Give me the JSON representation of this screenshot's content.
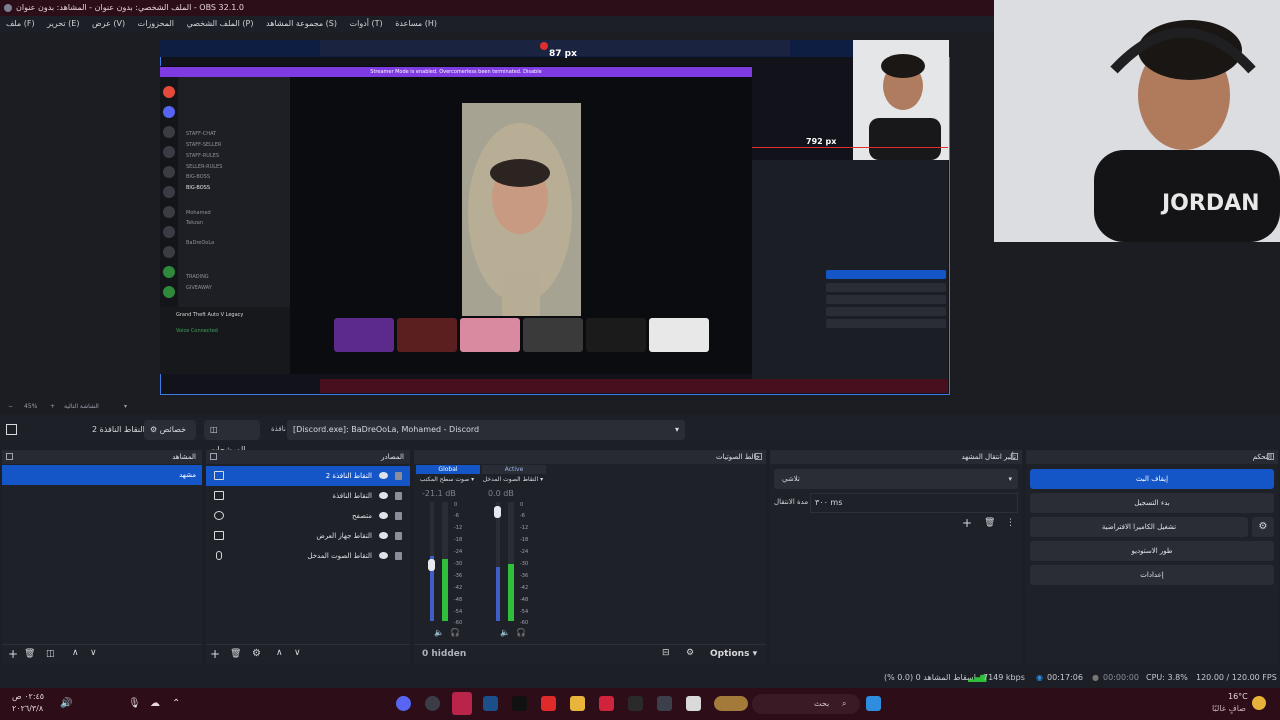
{
  "window": {
    "title": "الملف الشخصي: بدون عنوان - المشاهد: بدون عنوان - OBS 32.1.0"
  },
  "menu": [
    "ملف (F)",
    "تحرير (E)",
    "عرض (V)",
    "المحزوزات",
    "الملف الشخصي (P)",
    "مجموعة المشاهد (S)",
    "أدوات (T)",
    "مساعدة (H)"
  ],
  "preview": {
    "label_87": "87 px",
    "label_792": "792 px",
    "zoom": "45%",
    "zoom_label": "الشاشة التالية"
  },
  "discord": {
    "banner": "Streamer Mode is enabled. Overcomerless been terminated.  Disable",
    "channels": [
      "STAFF-CHAT",
      "STAFF-SELLER",
      "STAFF-RULES",
      "SELLER-RULES",
      "BIG-BOSS",
      "BIG-BOSS",
      "Mohamed",
      "Tekzan",
      "BaDreOoLa",
      "TRADING",
      "GIVEAWAY"
    ],
    "game": "Grand Theft Auto V Legacy",
    "voice": "Voice Connected"
  },
  "source_toolbar": {
    "source_name": "النقاط النافذة 2",
    "properties": "خصائص",
    "filters": "المرشحات",
    "window_label": "نافذة",
    "window_value": "[Discord.exe]: BaDreOoLa, Mohamed - Discord"
  },
  "docks": {
    "scenes": {
      "title": "المشاهد",
      "items": [
        "مشهد"
      ]
    },
    "sources": {
      "title": "المصادر",
      "items": [
        "التقاط النافذة 2",
        "التقاط النافذة",
        "متصفح",
        "التقاط جهاز العرض",
        "التقاط الصوت المدخل"
      ]
    },
    "mixer": {
      "title": "خالط الصوتيات",
      "tab_global": "Global",
      "tab_active": "Active",
      "strips": [
        {
          "name": "صوت سطح المكتب",
          "db": "-21.1 dB",
          "level": 0.55
        },
        {
          "name": "التقاط الصوت المدخل",
          "db": "0.0 dB",
          "level": 0.45
        }
      ],
      "ticks": [
        "0",
        "-6",
        "-12",
        "-18",
        "-24",
        "-30",
        "-36",
        "-42",
        "-48",
        "-54",
        "-60"
      ],
      "hidden": "0 hidden",
      "options": "Options"
    },
    "transitions": {
      "title": "تأثير انتقال المشهد",
      "type": "تلاشي",
      "duration_label": "مدة الانتقال",
      "duration": "٣٠٠ ms"
    },
    "controls": {
      "title": "التحكم",
      "stop_stream": "إيقاف البث",
      "start_record": "بدء التسجيل",
      "virtual_cam": "تشغيل الكاميرا الافتراضية",
      "studio": "طور الاستوديو",
      "settings": "إعدادات"
    }
  },
  "status": {
    "dropped": "إسقاط المشاهد 0 (0.0 %)",
    "bitrate": "7149 kbps",
    "stream_time": "00:17:06",
    "rec_time": "00:00:00",
    "cpu": "CPU: 3.8%",
    "fps": "120.00 / 120.00 FPS"
  },
  "taskbar": {
    "search": "بحث",
    "weather_temp": "16°C",
    "weather_desc": "صافٍ غالبًا",
    "time": "٠٢:٤٥ ص",
    "date": "٢٠٢٦/٣/٨"
  },
  "colors": {
    "accent": "#1456c8",
    "stream_active": "#1456c8",
    "title_bg": "#2b0e18",
    "taskbar_bg": "#2c0d18"
  }
}
